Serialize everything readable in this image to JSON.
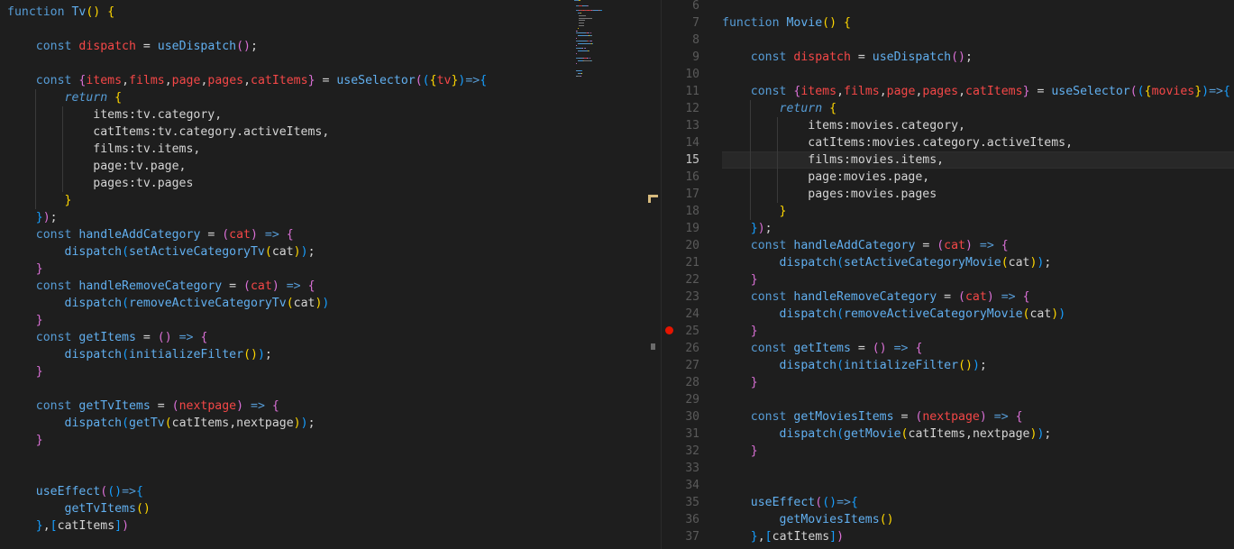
{
  "left_editor": {
    "lines": [
      [
        [
          "k",
          "function "
        ],
        [
          "f",
          "Tv"
        ],
        [
          "b1",
          "()"
        ],
        [
          "p",
          " "
        ],
        [
          "b1",
          "{"
        ]
      ],
      [],
      [
        [
          "p",
          "    "
        ],
        [
          "k",
          "const "
        ],
        [
          "v",
          "dispatch"
        ],
        [
          "p",
          " = "
        ],
        [
          "f",
          "useDispatch"
        ],
        [
          "b2",
          "()"
        ],
        [
          "p",
          ";"
        ]
      ],
      [],
      [
        [
          "p",
          "    "
        ],
        [
          "k",
          "const "
        ],
        [
          "b2",
          "{"
        ],
        [
          "v",
          "items"
        ],
        [
          "p",
          ","
        ],
        [
          "v",
          "films"
        ],
        [
          "p",
          ","
        ],
        [
          "v",
          "page"
        ],
        [
          "p",
          ","
        ],
        [
          "v",
          "pages"
        ],
        [
          "p",
          ","
        ],
        [
          "v",
          "catItems"
        ],
        [
          "b2",
          "}"
        ],
        [
          "p",
          " = "
        ],
        [
          "f",
          "useSelector"
        ],
        [
          "b2",
          "("
        ],
        [
          "b3",
          "("
        ],
        [
          "b1",
          "{"
        ],
        [
          "v",
          "tv"
        ],
        [
          "b1",
          "}"
        ],
        [
          "b3",
          ")"
        ],
        [
          "k",
          "=>"
        ],
        [
          "b3",
          "{"
        ]
      ],
      [
        [
          "p",
          "        "
        ],
        [
          "kr",
          "return "
        ],
        [
          "b1",
          "{"
        ]
      ],
      [
        [
          "p",
          "            items:tv.category,"
        ]
      ],
      [
        [
          "p",
          "            catItems:tv.category.activeItems,"
        ]
      ],
      [
        [
          "p",
          "            films:tv.items,"
        ]
      ],
      [
        [
          "p",
          "            page:tv.page,"
        ]
      ],
      [
        [
          "p",
          "            pages:tv.pages"
        ]
      ],
      [
        [
          "p",
          "        "
        ],
        [
          "b1",
          "}"
        ]
      ],
      [
        [
          "p",
          "    "
        ],
        [
          "b3",
          "}"
        ],
        [
          "b2",
          ")"
        ],
        [
          "p",
          ";"
        ]
      ],
      [
        [
          "p",
          "    "
        ],
        [
          "k",
          "const "
        ],
        [
          "f",
          "handleAddCategory"
        ],
        [
          "p",
          " = "
        ],
        [
          "b2",
          "("
        ],
        [
          "v",
          "cat"
        ],
        [
          "b2",
          ")"
        ],
        [
          "p",
          " "
        ],
        [
          "k",
          "=>"
        ],
        [
          "p",
          " "
        ],
        [
          "b2",
          "{"
        ]
      ],
      [
        [
          "p",
          "        "
        ],
        [
          "f",
          "dispatch"
        ],
        [
          "b3",
          "("
        ],
        [
          "f",
          "setActiveCategoryTv"
        ],
        [
          "b1",
          "("
        ],
        [
          "p",
          "cat"
        ],
        [
          "b1",
          ")"
        ],
        [
          "b3",
          ")"
        ],
        [
          "p",
          ";"
        ]
      ],
      [
        [
          "p",
          "    "
        ],
        [
          "b2",
          "}"
        ]
      ],
      [
        [
          "p",
          "    "
        ],
        [
          "k",
          "const "
        ],
        [
          "f",
          "handleRemoveCategory"
        ],
        [
          "p",
          " = "
        ],
        [
          "b2",
          "("
        ],
        [
          "v",
          "cat"
        ],
        [
          "b2",
          ")"
        ],
        [
          "p",
          " "
        ],
        [
          "k",
          "=>"
        ],
        [
          "p",
          " "
        ],
        [
          "b2",
          "{"
        ]
      ],
      [
        [
          "p",
          "        "
        ],
        [
          "f",
          "dispatch"
        ],
        [
          "b3",
          "("
        ],
        [
          "f",
          "removeActiveCategoryTv"
        ],
        [
          "b1",
          "("
        ],
        [
          "p",
          "cat"
        ],
        [
          "b1",
          ")"
        ],
        [
          "b3",
          ")"
        ]
      ],
      [
        [
          "p",
          "    "
        ],
        [
          "b2",
          "}"
        ]
      ],
      [
        [
          "p",
          "    "
        ],
        [
          "k",
          "const "
        ],
        [
          "f",
          "getItems"
        ],
        [
          "p",
          " = "
        ],
        [
          "b2",
          "()"
        ],
        [
          "p",
          " "
        ],
        [
          "k",
          "=>"
        ],
        [
          "p",
          " "
        ],
        [
          "b2",
          "{"
        ]
      ],
      [
        [
          "p",
          "        "
        ],
        [
          "f",
          "dispatch"
        ],
        [
          "b3",
          "("
        ],
        [
          "f",
          "initializeFilter"
        ],
        [
          "b1",
          "()"
        ],
        [
          "b3",
          ")"
        ],
        [
          "p",
          ";"
        ]
      ],
      [
        [
          "p",
          "    "
        ],
        [
          "b2",
          "}"
        ]
      ],
      [],
      [
        [
          "p",
          "    "
        ],
        [
          "k",
          "const "
        ],
        [
          "f",
          "getTvItems"
        ],
        [
          "p",
          " = "
        ],
        [
          "b2",
          "("
        ],
        [
          "v",
          "nextpage"
        ],
        [
          "b2",
          ")"
        ],
        [
          "p",
          " "
        ],
        [
          "k",
          "=>"
        ],
        [
          "p",
          " "
        ],
        [
          "b2",
          "{"
        ]
      ],
      [
        [
          "p",
          "        "
        ],
        [
          "f",
          "dispatch"
        ],
        [
          "b3",
          "("
        ],
        [
          "f",
          "getTv"
        ],
        [
          "b1",
          "("
        ],
        [
          "p",
          "catItems,nextpage"
        ],
        [
          "b1",
          ")"
        ],
        [
          "b3",
          ")"
        ],
        [
          "p",
          ";"
        ]
      ],
      [
        [
          "p",
          "    "
        ],
        [
          "b2",
          "}"
        ]
      ],
      [],
      [],
      [
        [
          "p",
          "    "
        ],
        [
          "f",
          "useEffect"
        ],
        [
          "b2",
          "("
        ],
        [
          "b3",
          "()"
        ],
        [
          "k",
          "=>"
        ],
        [
          "b3",
          "{"
        ]
      ],
      [
        [
          "p",
          "        "
        ],
        [
          "f",
          "getTvItems"
        ],
        [
          "b1",
          "()"
        ]
      ],
      [
        [
          "p",
          "    "
        ],
        [
          "b3",
          "}"
        ],
        [
          "p",
          ","
        ],
        [
          "b3",
          "["
        ],
        [
          "p",
          "catItems"
        ],
        [
          "b3",
          "]"
        ],
        [
          "b2",
          ")"
        ]
      ]
    ]
  },
  "right_editor": {
    "line_numbers": [
      "6",
      "7",
      "8",
      "9",
      "10",
      "11",
      "12",
      "13",
      "14",
      "15",
      "16",
      "17",
      "18",
      "19",
      "20",
      "21",
      "22",
      "23",
      "24",
      "25",
      "26",
      "27",
      "28",
      "29",
      "30",
      "31",
      "32",
      "33",
      "34",
      "35",
      "36",
      "37"
    ],
    "active_line": "15",
    "lines": [
      [],
      [
        [
          "k",
          "function "
        ],
        [
          "f",
          "Movie"
        ],
        [
          "b1",
          "()"
        ],
        [
          "p",
          " "
        ],
        [
          "b1",
          "{"
        ]
      ],
      [],
      [
        [
          "p",
          "    "
        ],
        [
          "k",
          "const "
        ],
        [
          "v",
          "dispatch"
        ],
        [
          "p",
          " = "
        ],
        [
          "f",
          "useDispatch"
        ],
        [
          "b2",
          "()"
        ],
        [
          "p",
          ";"
        ]
      ],
      [],
      [
        [
          "p",
          "    "
        ],
        [
          "k",
          "const "
        ],
        [
          "b2",
          "{"
        ],
        [
          "v",
          "items"
        ],
        [
          "p",
          ","
        ],
        [
          "v",
          "films"
        ],
        [
          "p",
          ","
        ],
        [
          "v",
          "page"
        ],
        [
          "p",
          ","
        ],
        [
          "v",
          "pages"
        ],
        [
          "p",
          ","
        ],
        [
          "v",
          "catItems"
        ],
        [
          "b2",
          "}"
        ],
        [
          "p",
          " = "
        ],
        [
          "f",
          "useSelector"
        ],
        [
          "b2",
          "("
        ],
        [
          "b3",
          "("
        ],
        [
          "b1",
          "{"
        ],
        [
          "v",
          "movies"
        ],
        [
          "b1",
          "}"
        ],
        [
          "b3",
          ")"
        ],
        [
          "k",
          "=>"
        ],
        [
          "b3",
          "{"
        ]
      ],
      [
        [
          "p",
          "        "
        ],
        [
          "kr",
          "return "
        ],
        [
          "b1",
          "{"
        ]
      ],
      [
        [
          "p",
          "            items:movies.category,"
        ]
      ],
      [
        [
          "p",
          "            catItems:movies.category.activeItems,"
        ]
      ],
      [
        [
          "p",
          "            films:movies.items,"
        ]
      ],
      [
        [
          "p",
          "            page:movies.page,"
        ]
      ],
      [
        [
          "p",
          "            pages:movies.pages"
        ]
      ],
      [
        [
          "p",
          "        "
        ],
        [
          "b1",
          "}"
        ]
      ],
      [
        [
          "p",
          "    "
        ],
        [
          "b3",
          "}"
        ],
        [
          "b2",
          ")"
        ],
        [
          "p",
          ";"
        ]
      ],
      [
        [
          "p",
          "    "
        ],
        [
          "k",
          "const "
        ],
        [
          "f",
          "handleAddCategory"
        ],
        [
          "p",
          " = "
        ],
        [
          "b2",
          "("
        ],
        [
          "v",
          "cat"
        ],
        [
          "b2",
          ")"
        ],
        [
          "p",
          " "
        ],
        [
          "k",
          "=>"
        ],
        [
          "p",
          " "
        ],
        [
          "b2",
          "{"
        ]
      ],
      [
        [
          "p",
          "        "
        ],
        [
          "f",
          "dispatch"
        ],
        [
          "b3",
          "("
        ],
        [
          "f",
          "setActiveCategoryMovie"
        ],
        [
          "b1",
          "("
        ],
        [
          "p",
          "cat"
        ],
        [
          "b1",
          ")"
        ],
        [
          "b3",
          ")"
        ],
        [
          "p",
          ";"
        ]
      ],
      [
        [
          "p",
          "    "
        ],
        [
          "b2",
          "}"
        ]
      ],
      [
        [
          "p",
          "    "
        ],
        [
          "k",
          "const "
        ],
        [
          "f",
          "handleRemoveCategory"
        ],
        [
          "p",
          " = "
        ],
        [
          "b2",
          "("
        ],
        [
          "v",
          "cat"
        ],
        [
          "b2",
          ")"
        ],
        [
          "p",
          " "
        ],
        [
          "k",
          "=>"
        ],
        [
          "p",
          " "
        ],
        [
          "b2",
          "{"
        ]
      ],
      [
        [
          "p",
          "        "
        ],
        [
          "f",
          "dispatch"
        ],
        [
          "b3",
          "("
        ],
        [
          "f",
          "removeActiveCategoryMovie"
        ],
        [
          "b1",
          "("
        ],
        [
          "p",
          "cat"
        ],
        [
          "b1",
          ")"
        ],
        [
          "b3",
          ")"
        ]
      ],
      [
        [
          "p",
          "    "
        ],
        [
          "b2",
          "}"
        ]
      ],
      [
        [
          "p",
          "    "
        ],
        [
          "k",
          "const "
        ],
        [
          "f",
          "getItems"
        ],
        [
          "p",
          " = "
        ],
        [
          "b2",
          "()"
        ],
        [
          "p",
          " "
        ],
        [
          "k",
          "=>"
        ],
        [
          "p",
          " "
        ],
        [
          "b2",
          "{"
        ]
      ],
      [
        [
          "p",
          "        "
        ],
        [
          "f",
          "dispatch"
        ],
        [
          "b3",
          "("
        ],
        [
          "f",
          "initializeFilter"
        ],
        [
          "b1",
          "()"
        ],
        [
          "b3",
          ")"
        ],
        [
          "p",
          ";"
        ]
      ],
      [
        [
          "p",
          "    "
        ],
        [
          "b2",
          "}"
        ]
      ],
      [],
      [
        [
          "p",
          "    "
        ],
        [
          "k",
          "const "
        ],
        [
          "f",
          "getMoviesItems"
        ],
        [
          "p",
          " = "
        ],
        [
          "b2",
          "("
        ],
        [
          "v",
          "nextpage"
        ],
        [
          "b2",
          ")"
        ],
        [
          "p",
          " "
        ],
        [
          "k",
          "=>"
        ],
        [
          "p",
          " "
        ],
        [
          "b2",
          "{"
        ]
      ],
      [
        [
          "p",
          "        "
        ],
        [
          "f",
          "dispatch"
        ],
        [
          "b3",
          "("
        ],
        [
          "f",
          "getMovie"
        ],
        [
          "b1",
          "("
        ],
        [
          "p",
          "catItems,nextpage"
        ],
        [
          "b1",
          ")"
        ],
        [
          "b3",
          ")"
        ],
        [
          "p",
          ";"
        ]
      ],
      [
        [
          "p",
          "    "
        ],
        [
          "b2",
          "}"
        ]
      ],
      [],
      [],
      [
        [
          "p",
          "    "
        ],
        [
          "f",
          "useEffect"
        ],
        [
          "b2",
          "("
        ],
        [
          "b3",
          "()"
        ],
        [
          "k",
          "=>"
        ],
        [
          "b3",
          "{"
        ]
      ],
      [
        [
          "p",
          "        "
        ],
        [
          "f",
          "getMoviesItems"
        ],
        [
          "b1",
          "()"
        ]
      ],
      [
        [
          "p",
          "    "
        ],
        [
          "b3",
          "}"
        ],
        [
          "p",
          ","
        ],
        [
          "b3",
          "["
        ],
        [
          "p",
          "catItems"
        ],
        [
          "b3",
          "]"
        ],
        [
          "b2",
          ")"
        ]
      ]
    ]
  },
  "colors": {
    "background": "#1e1e1e",
    "keyword": "#569cd6",
    "variable": "#f44747",
    "function": "#61afef",
    "bracket_gold": "#ffd700",
    "bracket_orchid": "#da70d6",
    "bracket_blue": "#179fff",
    "breakpoint": "#e51400"
  },
  "icons": {
    "breakpoint": "breakpoint-dot-icon"
  }
}
